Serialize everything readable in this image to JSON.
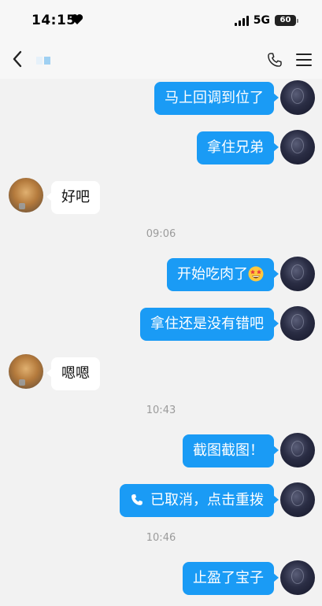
{
  "status_bar": {
    "time": "14:15",
    "network": "5G",
    "battery": "60"
  },
  "nav": {
    "title_colors": [
      "#e6f1fa",
      "#9fd0f2"
    ]
  },
  "messages": [
    {
      "side": "out",
      "text": "马上回调到位了"
    },
    {
      "side": "out",
      "text": "拿住兄弟"
    },
    {
      "side": "in",
      "text": "好吧"
    },
    {
      "type": "time",
      "text": "09:06"
    },
    {
      "side": "out",
      "text": "开始吃肉了",
      "emoji": "star-struck-emoji"
    },
    {
      "side": "out",
      "text": "拿住还是没有错吧"
    },
    {
      "side": "in",
      "text": "嗯嗯"
    },
    {
      "type": "time",
      "text": "10:43"
    },
    {
      "side": "out",
      "text": "截图截图！"
    },
    {
      "side": "out",
      "text": "已取消，点击重拨",
      "icon": "phone-icon"
    },
    {
      "type": "time",
      "text": "10:46"
    },
    {
      "side": "out",
      "text": "止盈了宝子"
    }
  ],
  "colors": {
    "outgoing_bubble": "#1a9bf5",
    "incoming_bubble": "#ffffff",
    "background": "#f2f2f2",
    "timestamp": "#9b9b9b"
  }
}
